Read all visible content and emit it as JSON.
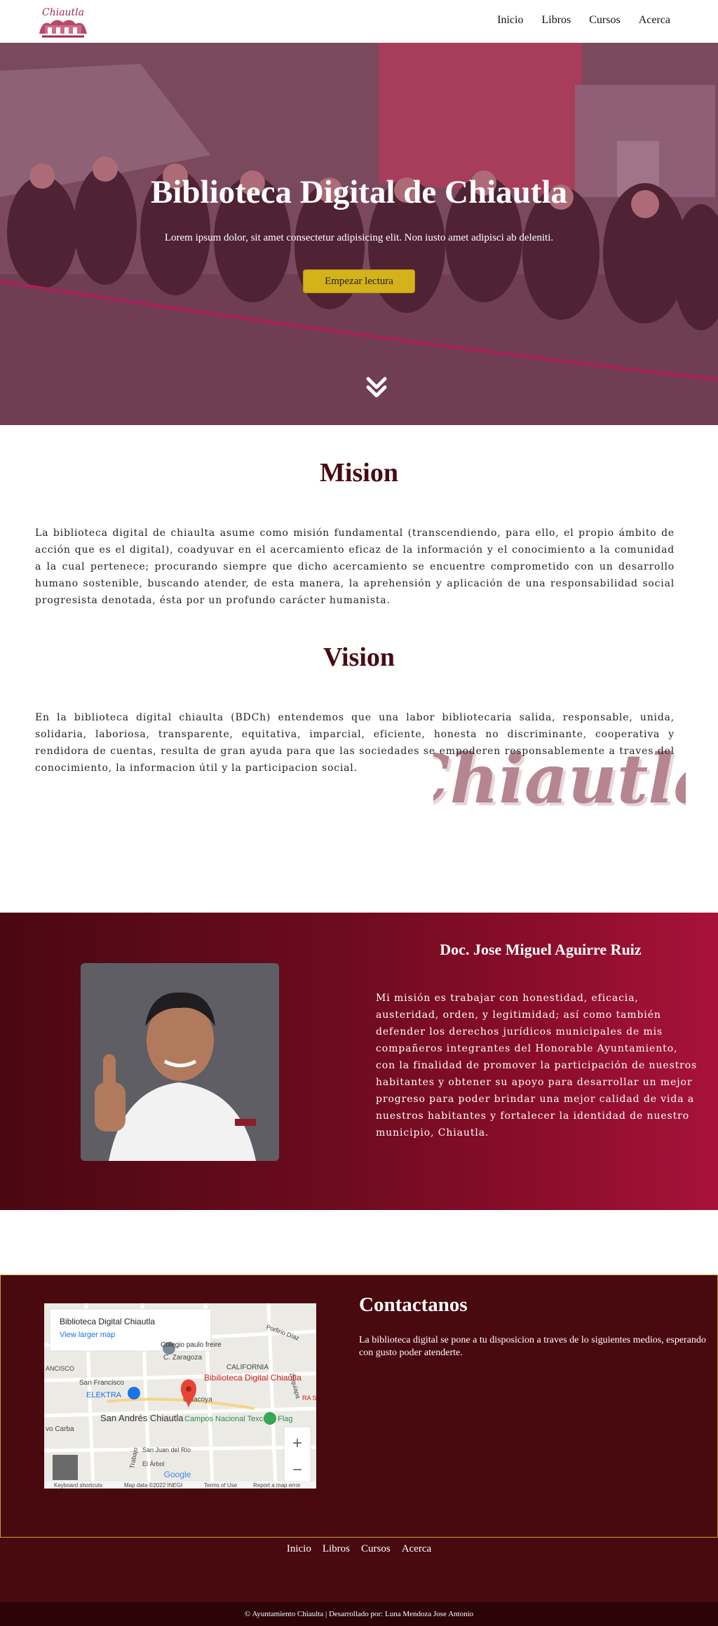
{
  "nav": {
    "logo_text": "Chiautla",
    "links": [
      "Inicio",
      "Libros",
      "Cursos",
      "Acerca"
    ]
  },
  "hero": {
    "title": "Biblioteca Digital de Chiautla",
    "subtitle": "Lorem ipsum dolor, sit amet consectetur adipisicing elit. Non iusto amet adipisci ab deleniti.",
    "button": "Empezar lectura",
    "scroll_icon": "double-chevron-down-icon"
  },
  "mision": {
    "title": "Mision",
    "text": "La biblioteca digital de chiaulta asume como misión fundamental (transcendiendo, para ello, el propio ámbito de acción que es el digital), coadyuvar en el acercamiento eficaz de la información y el conocimiento a la comunidad a la cual pertenece; procurando siempre que dicho acercamiento se encuentre comprometido con un desarrollo humano sostenible, buscando atender, de esta manera, la aprehensión y aplicación de una responsabilidad social progresista denotada, ésta por un profundo carácter humanista."
  },
  "vision": {
    "title": "Vision",
    "text": "En la biblioteca digital chiaulta (BDCh) entendemos que una labor bibliotecaria salida, responsable, unida, solidaria, laboriosa, transparente, equitativa, imparcial, eficiente, honesta no discriminante, cooperativa y rendidora de cuentas, resulta de gran ayuda para que las sociedades se empoderen responsablemente a traves del conocimiento, la informacion útil y la participacion social.",
    "watermark": "Chiautla"
  },
  "profile": {
    "name": "Doc. Jose Miguel Aguirre Ruiz",
    "text": "Mi misión es trabajar con honestidad, eficacia, austeridad, orden, y legitimidad; así como también defender los derechos jurídicos municipales de mis compañeros integrantes del Honorable Ayuntamiento, con la finalidad de promover la participación de nuestros habitantes y obtener su apoyo para desarrollar un mejor progreso para poder brindar una mejor calidad de vida a nuestros habitantes y fortalecer la identidad de nuestro municipio, Chiautla."
  },
  "contact": {
    "title": "Contactanos",
    "text": "La biblioteca digital se pone a tu disposicion a traves de lo siguientes medios, esperando con gusto poder atenderte.",
    "map": {
      "place_name": "Biblioteca Digital Chiautla",
      "larger_map": "View larger map",
      "labels": [
        "Colegio paulo freire",
        "C. Zaragoza",
        "Porfirio Díaz",
        "CALIFORNIA",
        "Zoquiapa",
        "San Francisco",
        "ELEKTRA",
        "Calacoya",
        "San Andrés Chiautla",
        "Campos Nacional Texcoco Flag",
        "San Juan del Río",
        "El Árbol",
        "Trabajo",
        "ANCISCO",
        "vo Carba",
        "RA SA"
      ],
      "pin_label": "Bibilioteca Digital Chiautla",
      "zoom_in": "+",
      "zoom_out": "−",
      "google": "Google",
      "footer": [
        "Keyboard shortcuts",
        "Map data ©2022 INEGI",
        "Terms of Use",
        "Report a map error"
      ]
    }
  },
  "footer": {
    "links": [
      "Inicio",
      "Libros",
      "Cursos",
      "Acerca"
    ],
    "copyright": "© Ayuntamiento Chiaulta | Desarrollado por: Luna Mendoza Jose Antonio"
  },
  "colors": {
    "brand_dark": "#48090f",
    "title": "#4a0a14",
    "button": "#d4b21a",
    "profile_gradient_start": "#4a0811",
    "profile_gradient_end": "#a8123a"
  }
}
